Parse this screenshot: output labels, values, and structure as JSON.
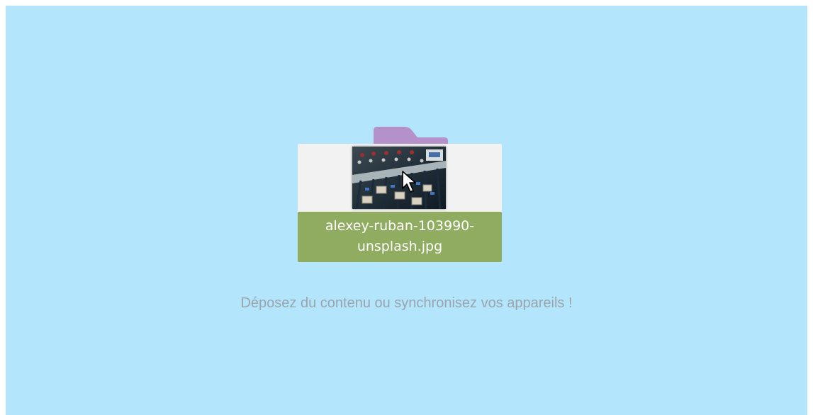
{
  "dropzone": {
    "background_color": "#b3e5fc",
    "hint_text": "Déposez du contenu ou synchronisez vos appareils !"
  },
  "dragged_file": {
    "name_line1": "alexey-ruban-103990-",
    "name_line2": "unsplash.jpg",
    "thumbnail_icon": "mixing-console-photo",
    "label_color": "#8fac61",
    "folder_tab_color": "#b491c8"
  },
  "cursor": {
    "icon": "arrow-cursor-icon"
  }
}
